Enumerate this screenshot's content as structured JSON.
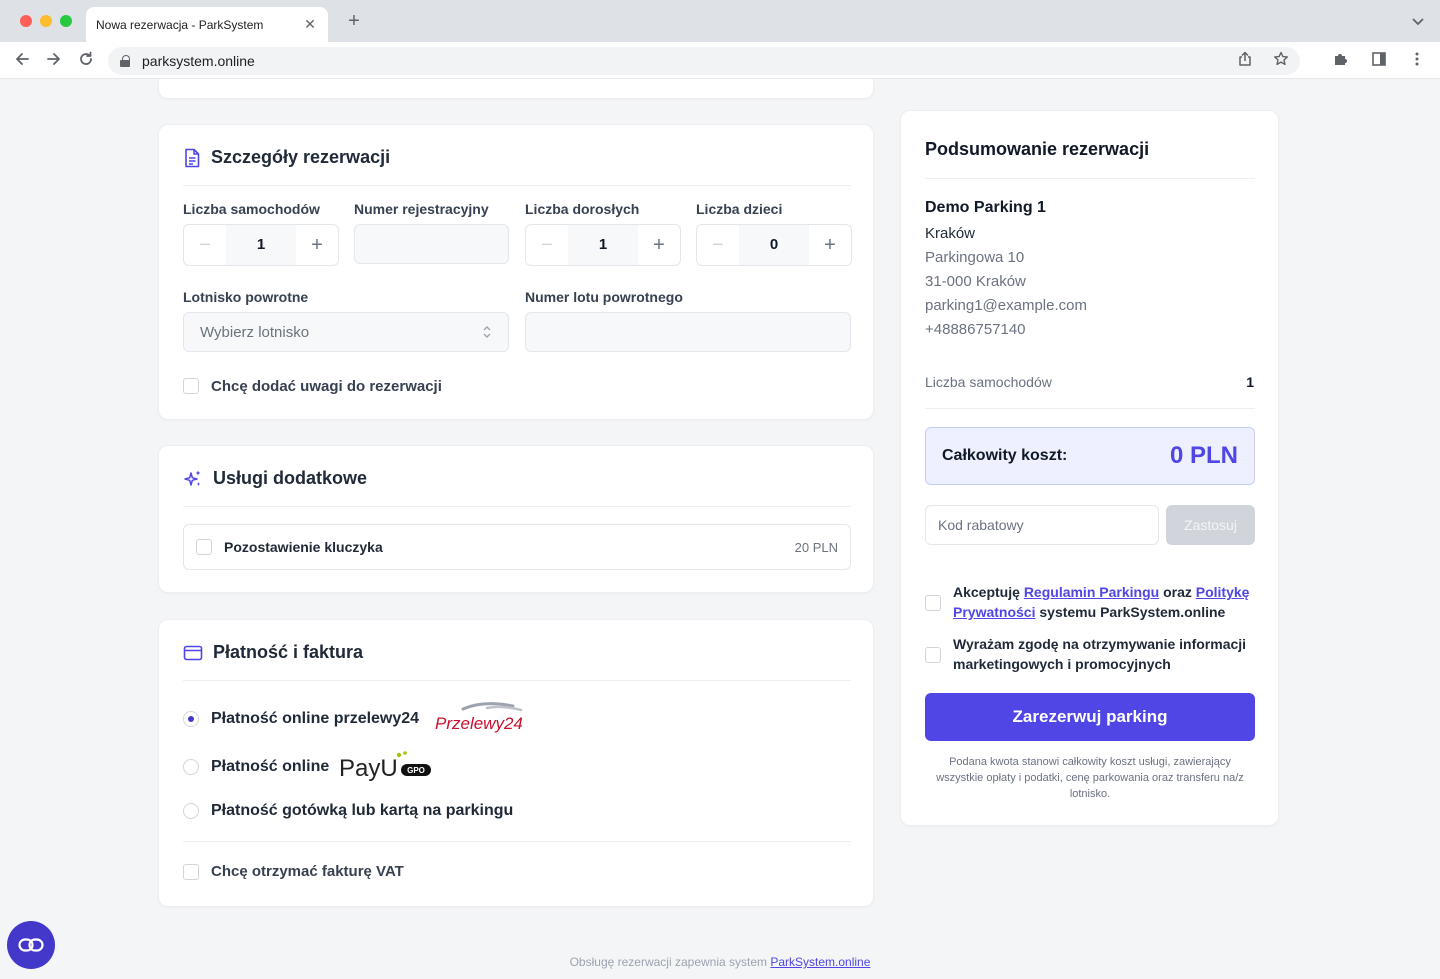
{
  "browser": {
    "tab_title": "Nowa rezerwacja - ParkSystem",
    "url": "parksystem.online"
  },
  "details": {
    "title": "Szczegóły rezerwacji",
    "cars_label": "Liczba samochodów",
    "cars_value": "1",
    "plate_label": "Numer rejestracyjny",
    "adults_label": "Liczba dorosłych",
    "adults_value": "1",
    "kids_label": "Liczba dzieci",
    "kids_value": "0",
    "airport_label": "Lotnisko powrotne",
    "airport_placeholder": "Wybierz lotnisko",
    "flight_label": "Numer lotu powrotnego",
    "notes_label": "Chcę dodać uwagi do rezerwacji"
  },
  "extras": {
    "title": "Usługi dodatkowe",
    "items": [
      {
        "label": "Pozostawienie kluczyka",
        "price": "20 PLN"
      }
    ]
  },
  "payment": {
    "title": "Płatność i faktura",
    "options": [
      {
        "label": "Płatność online przelewy24",
        "logo": "Przelewy24",
        "selected": true
      },
      {
        "label": "Płatność online",
        "logo": "PayU",
        "logo_badge": "GPO",
        "selected": false
      },
      {
        "label": "Płatność gotówką lub kartą na parkingu",
        "selected": false
      }
    ],
    "invoice_label": "Chcę otrzymać fakturę VAT"
  },
  "summary": {
    "title": "Podsumowanie rezerwacji",
    "parking_name": "Demo Parking 1",
    "city": "Kraków",
    "street": "Parkingowa 10",
    "postal": "31-000 Kraków",
    "email": "parking1@example.com",
    "phone": "+48886757140",
    "cars_label": "Liczba samochodów",
    "cars_value": "1",
    "total_label": "Całkowity koszt:",
    "total_value": "0 PLN",
    "discount_placeholder": "Kod rabatowy",
    "apply_label": "Zastosuj",
    "terms": {
      "accept": "Akceptuję",
      "regulamin": "Regulamin Parkingu",
      "oraz": "oraz",
      "polityke": "Politykę",
      "prywatnosci": "Prywatności",
      "systemu": "systemu ParkSystem.online"
    },
    "marketing_label": "Wyrażam zgodę na otrzymywanie informacji marketingowych i promocyjnych",
    "reserve_label": "Zarezerwuj parking",
    "note": "Podana kwota stanowi całkowity koszt usługi, zawierający wszystkie opłaty i podatki, cenę parkowania oraz transferu na/z lotnisko."
  },
  "footer": {
    "text": "Obsługę rezerwacji zapewnia system",
    "link": "ParkSystem.online"
  },
  "colors": {
    "accent": "#4f46e5",
    "accent_light": "#eef0ff",
    "p24_red": "#c8102e",
    "payu_green": "#a6c307"
  }
}
